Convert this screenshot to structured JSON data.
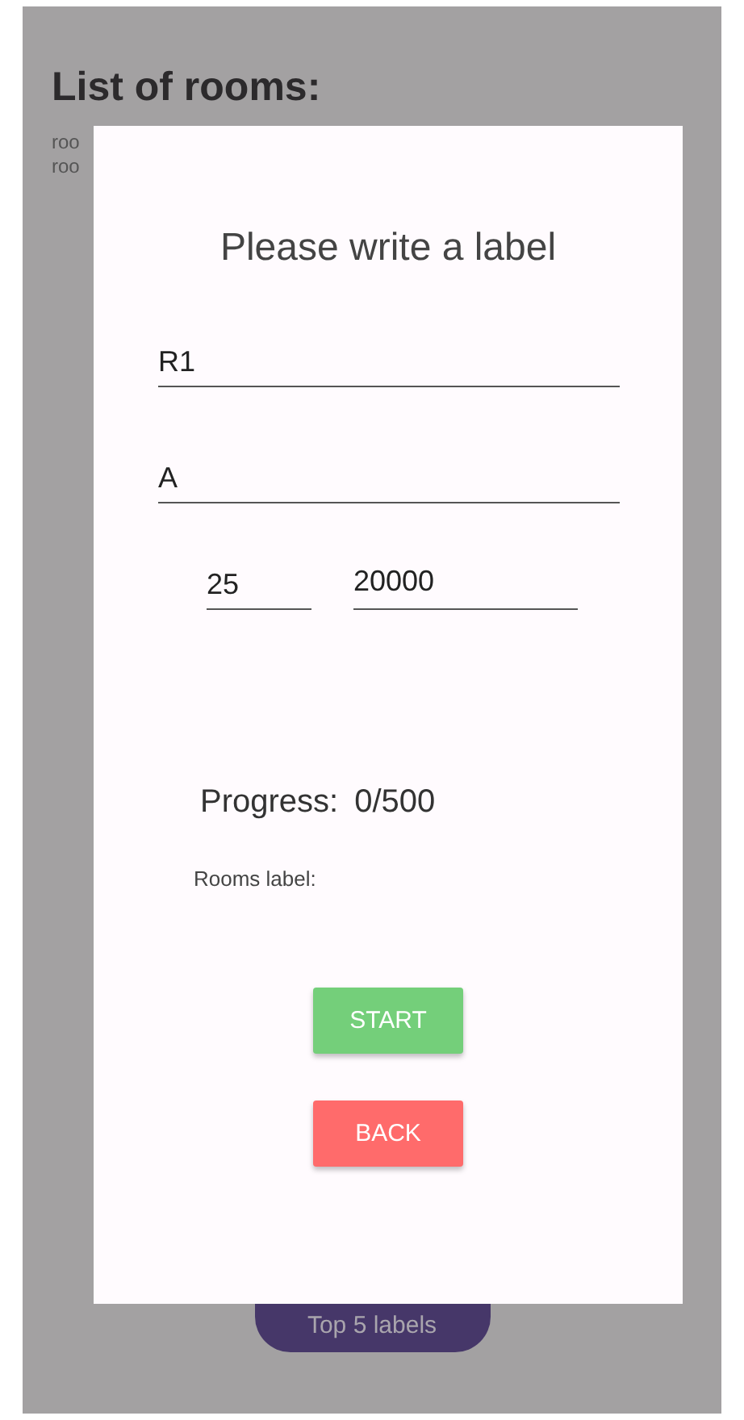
{
  "screen": {
    "title": "List of rooms:",
    "rooms": [
      "roo",
      "roo"
    ],
    "top_button": "Top 5 labels"
  },
  "dialog": {
    "title": "Please write a label",
    "fields": [
      {
        "value": "R1"
      },
      {
        "value": "A"
      },
      {
        "value": "25"
      },
      {
        "value": "20000"
      }
    ],
    "progress_label": "Progress:",
    "progress_value": "0/500",
    "rooms_label": "Rooms label:",
    "buttons": [
      {
        "label": "START",
        "kind": "start"
      },
      {
        "label": "BACK",
        "kind": "back"
      }
    ]
  }
}
